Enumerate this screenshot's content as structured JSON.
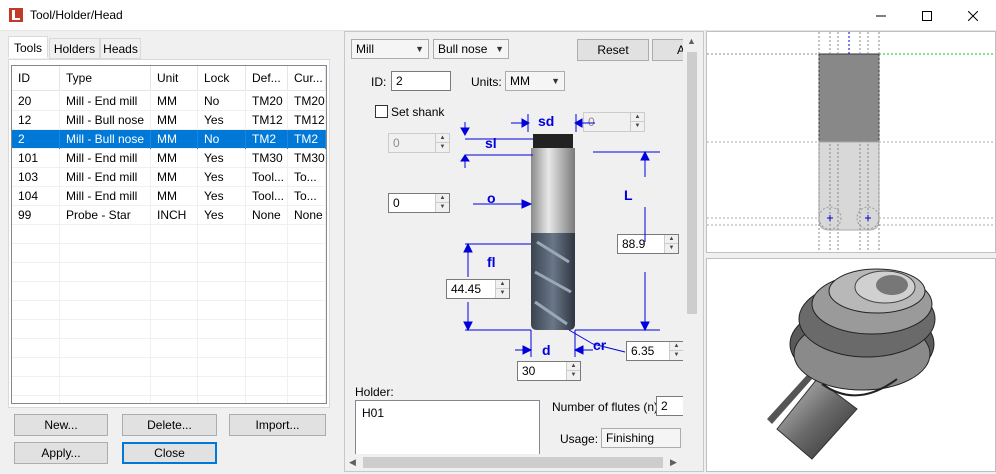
{
  "window": {
    "title": "Tool/Holder/Head"
  },
  "tabs": [
    "Tools",
    "Holders",
    "Heads"
  ],
  "table": {
    "columns": [
      "ID",
      "Type",
      "Unit",
      "Lock",
      "Def...",
      "Cur..."
    ],
    "rows": [
      [
        "20",
        "Mill - End mill",
        "MM",
        "No",
        "TM20",
        "TM20"
      ],
      [
        "12",
        "Mill - Bull nose",
        "MM",
        "Yes",
        "TM12",
        "TM12"
      ],
      [
        "2",
        "Mill - Bull nose",
        "MM",
        "No",
        "TM2",
        "TM2"
      ],
      [
        "101",
        "Mill - End mill",
        "MM",
        "Yes",
        "TM30",
        "TM30"
      ],
      [
        "103",
        "Mill - End mill",
        "MM",
        "Yes",
        "Tool...",
        "To..."
      ],
      [
        "104",
        "Mill - End mill",
        "MM",
        "Yes",
        "Tool...",
        "To..."
      ],
      [
        "99",
        "Probe - Star",
        "INCH",
        "Yes",
        "None",
        "None"
      ]
    ],
    "selected_row": 2
  },
  "buttons": {
    "new": "New...",
    "delete": "Delete...",
    "import": "Import...",
    "apply": "Apply...",
    "close": "Close",
    "reset": "Reset",
    "a": "A"
  },
  "tool": {
    "type": "Mill",
    "subtype": "Bull nose",
    "id_label": "ID:",
    "id": "2",
    "units_label": "Units:",
    "units": "MM",
    "set_shank_label": "Set shank",
    "set_shank_checked": false,
    "sl_value": "0",
    "sd_value": "0",
    "o_value": "0",
    "L_value": "88.9",
    "fl_value": "44.45",
    "cr_value": "6.35",
    "d_value": "30",
    "holder_label": "Holder:",
    "holder_item": "H01",
    "flutes_label": "Number of flutes (n)",
    "flutes": "2",
    "usage_label": "Usage:",
    "usage": "Finishing"
  },
  "dims": {
    "sd": "sd",
    "sl": "sl",
    "o": "o",
    "L": "L",
    "fl": "fl",
    "d": "d",
    "cr": "cr"
  },
  "colors": {
    "selection": "#0078d7",
    "dimension": "#0000dd",
    "accent_red": "#c0392b"
  }
}
